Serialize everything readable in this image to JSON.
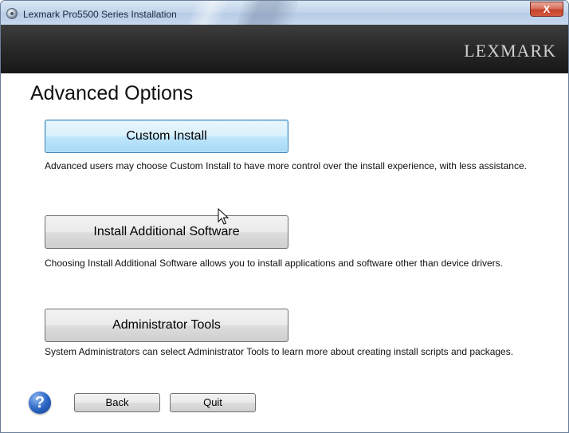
{
  "window": {
    "title": "Lexmark Pro5500 Series Installation",
    "close_glyph": "X"
  },
  "brand": {
    "logo_text": "LEXMARK"
  },
  "page": {
    "heading": "Advanced Options"
  },
  "options": [
    {
      "label": "Custom Install",
      "description": "Advanced users may choose Custom Install to have more control over the install experience, with less assistance."
    },
    {
      "label": "Install Additional Software",
      "description": "Choosing Install Additional Software allows you to install applications and software other than device drivers."
    },
    {
      "label": "Administrator Tools",
      "description": "System Administrators can select Administrator Tools to learn more about creating install scripts and packages."
    }
  ],
  "footer": {
    "help_glyph": "?",
    "back_label": "Back",
    "quit_label": "Quit"
  },
  "icons": {
    "app": "installer-disc-icon",
    "help": "help-icon",
    "cursor": "mouse-cursor-icon"
  },
  "colors": {
    "brand_bar": "#1f1f1f",
    "focus_border": "#3c7fb1",
    "close_button": "#c7432c",
    "help_icon": "#2d68c7"
  }
}
